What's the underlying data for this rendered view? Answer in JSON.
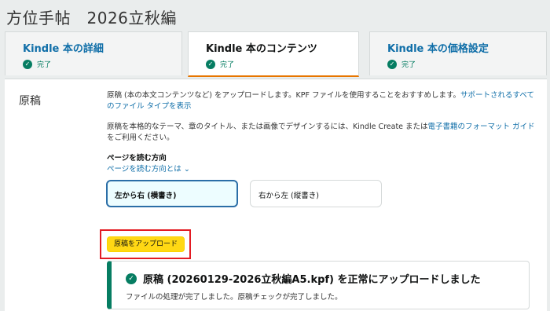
{
  "book_title": "方位手帖　2026立秋編",
  "tabs": [
    {
      "label": "Kindle 本の詳細",
      "status": "完了",
      "active": false
    },
    {
      "label": "Kindle 本のコンテンツ",
      "status": "完了",
      "active": true
    },
    {
      "label": "Kindle 本の価格設定",
      "status": "完了",
      "active": false
    }
  ],
  "manuscript": {
    "section_label": "原稿",
    "intro_text": "原稿 (本の本文コンテンツなど) をアップロードします。KPF ファイルを使用することをおすすめします。",
    "intro_link": "サポートされるすべてのファイル タイプを表示",
    "design_text": "原稿を本格的なテーマ、章のタイトル、または画像でデザインするには、Kindle Create または",
    "design_link": "電子書籍のフォーマット ガイド",
    "design_text_end": "をご利用ください。",
    "reading_direction_title": "ページを読む方向",
    "reading_direction_link": "ページを読む方向とは ⌄",
    "direction_options": [
      {
        "label": "左から右 (横書き)",
        "selected": true
      },
      {
        "label": "右から左 (縦書き)",
        "selected": false
      }
    ],
    "upload_button": "原稿をアップロード",
    "success_title": "原稿 (20260129-2026立秋編A5.kpf) を正常にアップロードしました",
    "success_message": "ファイルの処理が完了しました。原稿チェックが完了しました。"
  },
  "colors": {
    "accent_link": "#0f6ea8",
    "success_green": "#067d62",
    "upload_yellow": "#ffd814",
    "highlight_red": "#e31b23"
  }
}
